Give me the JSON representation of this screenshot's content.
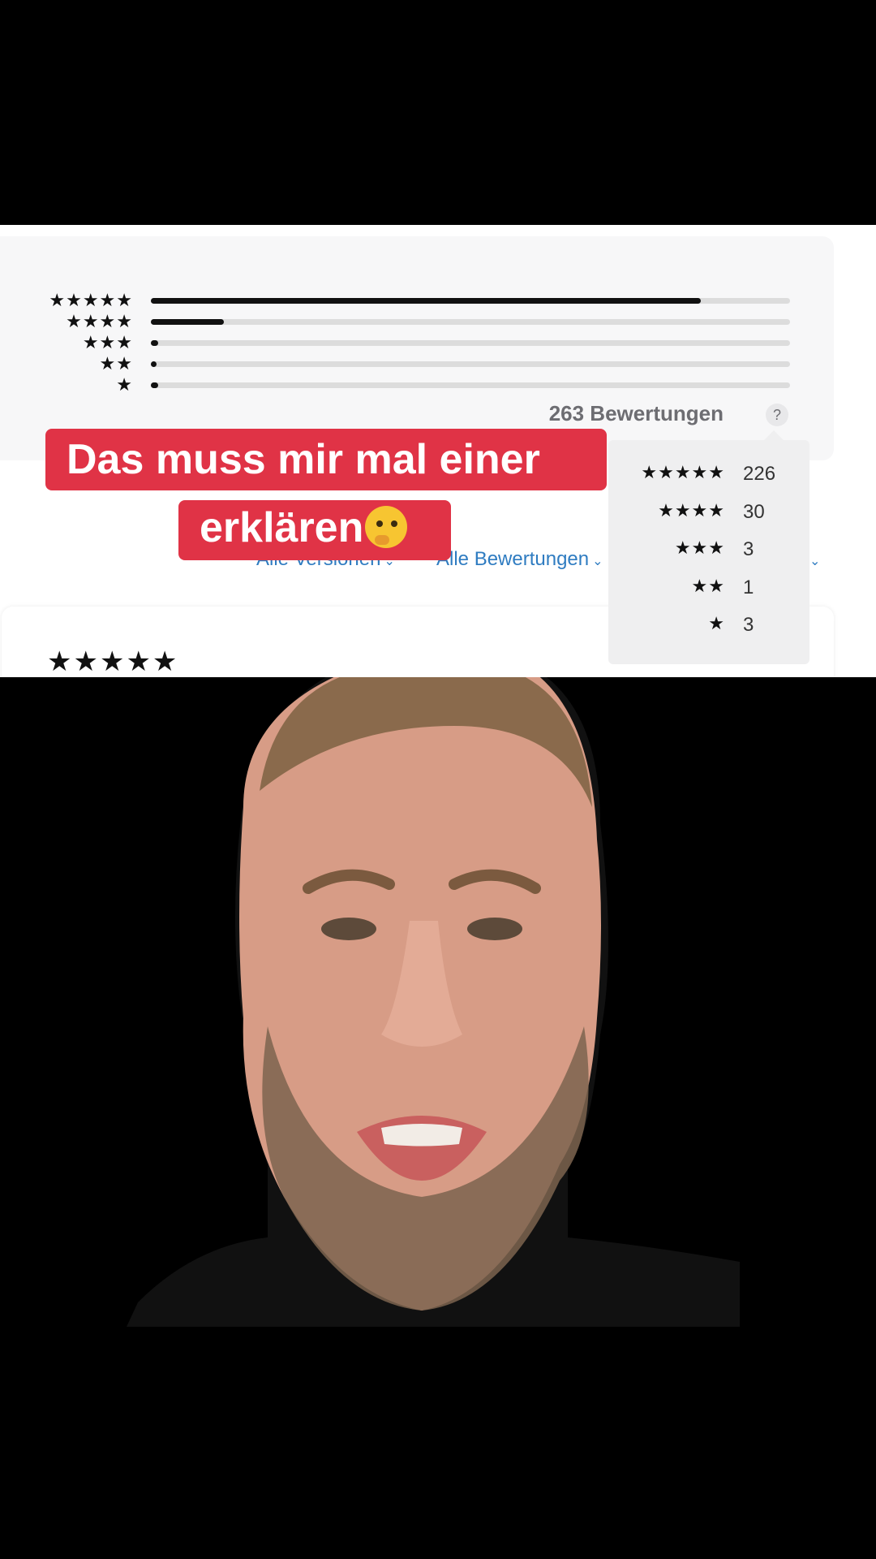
{
  "ratings": {
    "rows": [
      {
        "stars": "★★★★★",
        "fraction": 0.86
      },
      {
        "stars": "★★★★",
        "fraction": 0.114
      },
      {
        "stars": "★★★",
        "fraction": 0.011
      },
      {
        "stars": "★★",
        "fraction": 0.004
      },
      {
        "stars": "★",
        "fraction": 0.011
      }
    ],
    "total_label": "263 Bewertungen",
    "help_label": "?"
  },
  "popover": {
    "rows": [
      {
        "stars": "★★★★★",
        "count": "226"
      },
      {
        "stars": "★★★★",
        "count": "30"
      },
      {
        "stars": "★★★",
        "count": "3"
      },
      {
        "stars": "★★",
        "count": "1"
      },
      {
        "stars": "★",
        "count": "3"
      }
    ]
  },
  "filters": {
    "versions_label": "Alle Versionen",
    "ratings_label": "Alle Bewertungen",
    "chevron": "⌄"
  },
  "review": {
    "stars": "★★★★★"
  },
  "caption": {
    "line1": "Das muss mir mal einer",
    "line2": "erklären",
    "emoji_name": "thinking-face-emoji"
  },
  "colors": {
    "caption_bg": "#e03346",
    "link": "#2f7cc1",
    "bar_fill": "#111111",
    "bar_track": "#dcdcdc"
  }
}
